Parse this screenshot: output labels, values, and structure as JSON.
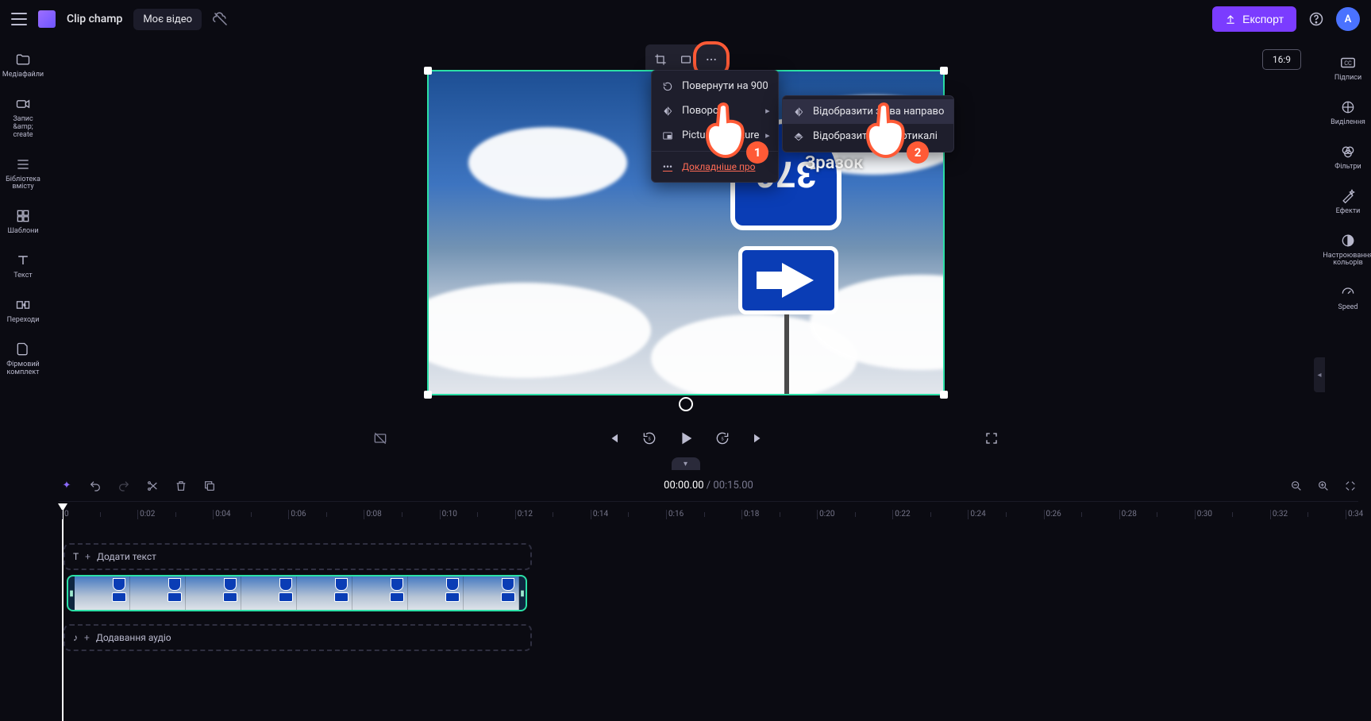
{
  "header": {
    "brand": "Clip champ",
    "project_name": "Моє відео",
    "export_label": "Експорт",
    "avatar_letter": "A",
    "aspect_ratio": "16:9"
  },
  "sidebar_left": {
    "items": [
      {
        "label": "Медіафайли"
      },
      {
        "label": "Запис &amp; create"
      },
      {
        "label": "Бібліотека вмісту"
      },
      {
        "label": "Шаблони"
      },
      {
        "label": "Текст"
      },
      {
        "label": "Переходи"
      },
      {
        "label": "Фірмовий комплект"
      }
    ]
  },
  "sidebar_right": {
    "items": [
      {
        "label": "Підписи"
      },
      {
        "label": "Виділення"
      },
      {
        "label": "Фільтри"
      },
      {
        "label": "Ефекти"
      },
      {
        "label": "Настроювання кольорів"
      },
      {
        "label": "Speed"
      }
    ]
  },
  "context_menu": {
    "rotate_90": "Повернути на 900",
    "flip": "Поворот",
    "pip": "Picture in picture",
    "learn_more": "Докладніше про"
  },
  "flip_submenu": {
    "horizontal": "Відобразити зліва направо",
    "vertical": "Відобразити по вертикалі"
  },
  "tutorial": {
    "step1": "1",
    "step2": "2"
  },
  "preview": {
    "sample_label": "Зразок",
    "sign_number": "376"
  },
  "timeline": {
    "current_time": "00:00.00",
    "separator": " / ",
    "total_time": "00:15.00",
    "text_track_label": "Додати текст",
    "audio_track_label": "Додавання аудіо",
    "ruler_marks": [
      "0",
      "0:02",
      "0:04",
      "0:06",
      "0:08",
      "0:10",
      "0:12",
      "0:14",
      "0:16",
      "0:18",
      "0:20",
      "0:22",
      "0:24",
      "0:26",
      "0:28",
      "0:30",
      "0:32",
      "0:34"
    ]
  }
}
